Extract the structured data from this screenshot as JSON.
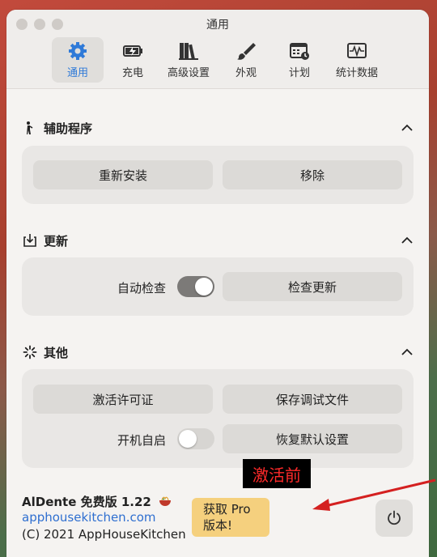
{
  "window": {
    "title": "通用"
  },
  "tabs": [
    {
      "label": "通用",
      "icon": "gear-icon",
      "active": true
    },
    {
      "label": "充电",
      "icon": "battery-icon",
      "active": false
    },
    {
      "label": "高级设置",
      "icon": "books-icon",
      "active": false
    },
    {
      "label": "外观",
      "icon": "paintbrush-icon",
      "active": false
    },
    {
      "label": "计划",
      "icon": "calendar-clock-icon",
      "active": false
    },
    {
      "label": "统计数据",
      "icon": "waveform-icon",
      "active": false
    }
  ],
  "helper": {
    "title": "辅助程序",
    "reinstall_label": "重新安装",
    "remove_label": "移除"
  },
  "update": {
    "title": "更新",
    "auto_check_label": "自动检查",
    "auto_check_on": true,
    "check_update_label": "检查更新"
  },
  "other": {
    "title": "其他",
    "activate_license_label": "激活许可证",
    "save_debug_label": "保存调试文件",
    "launch_at_login_label": "开机自启",
    "launch_at_login_on": false,
    "restore_defaults_label": "恢复默认设置"
  },
  "footer": {
    "app_version": "AlDente 免费版 1.22",
    "website": "apphousekitchen.com",
    "copyright": "(C) 2021 AppHouseKitchen",
    "pro_line1": "获取 Pro",
    "pro_line2": "版本!"
  },
  "annotation": {
    "text": "激活前",
    "color": "#ff2a2a"
  },
  "colors": {
    "accent": "#2f7ad8",
    "pro_button": "#f5d07e",
    "link": "#2f6fd0"
  }
}
